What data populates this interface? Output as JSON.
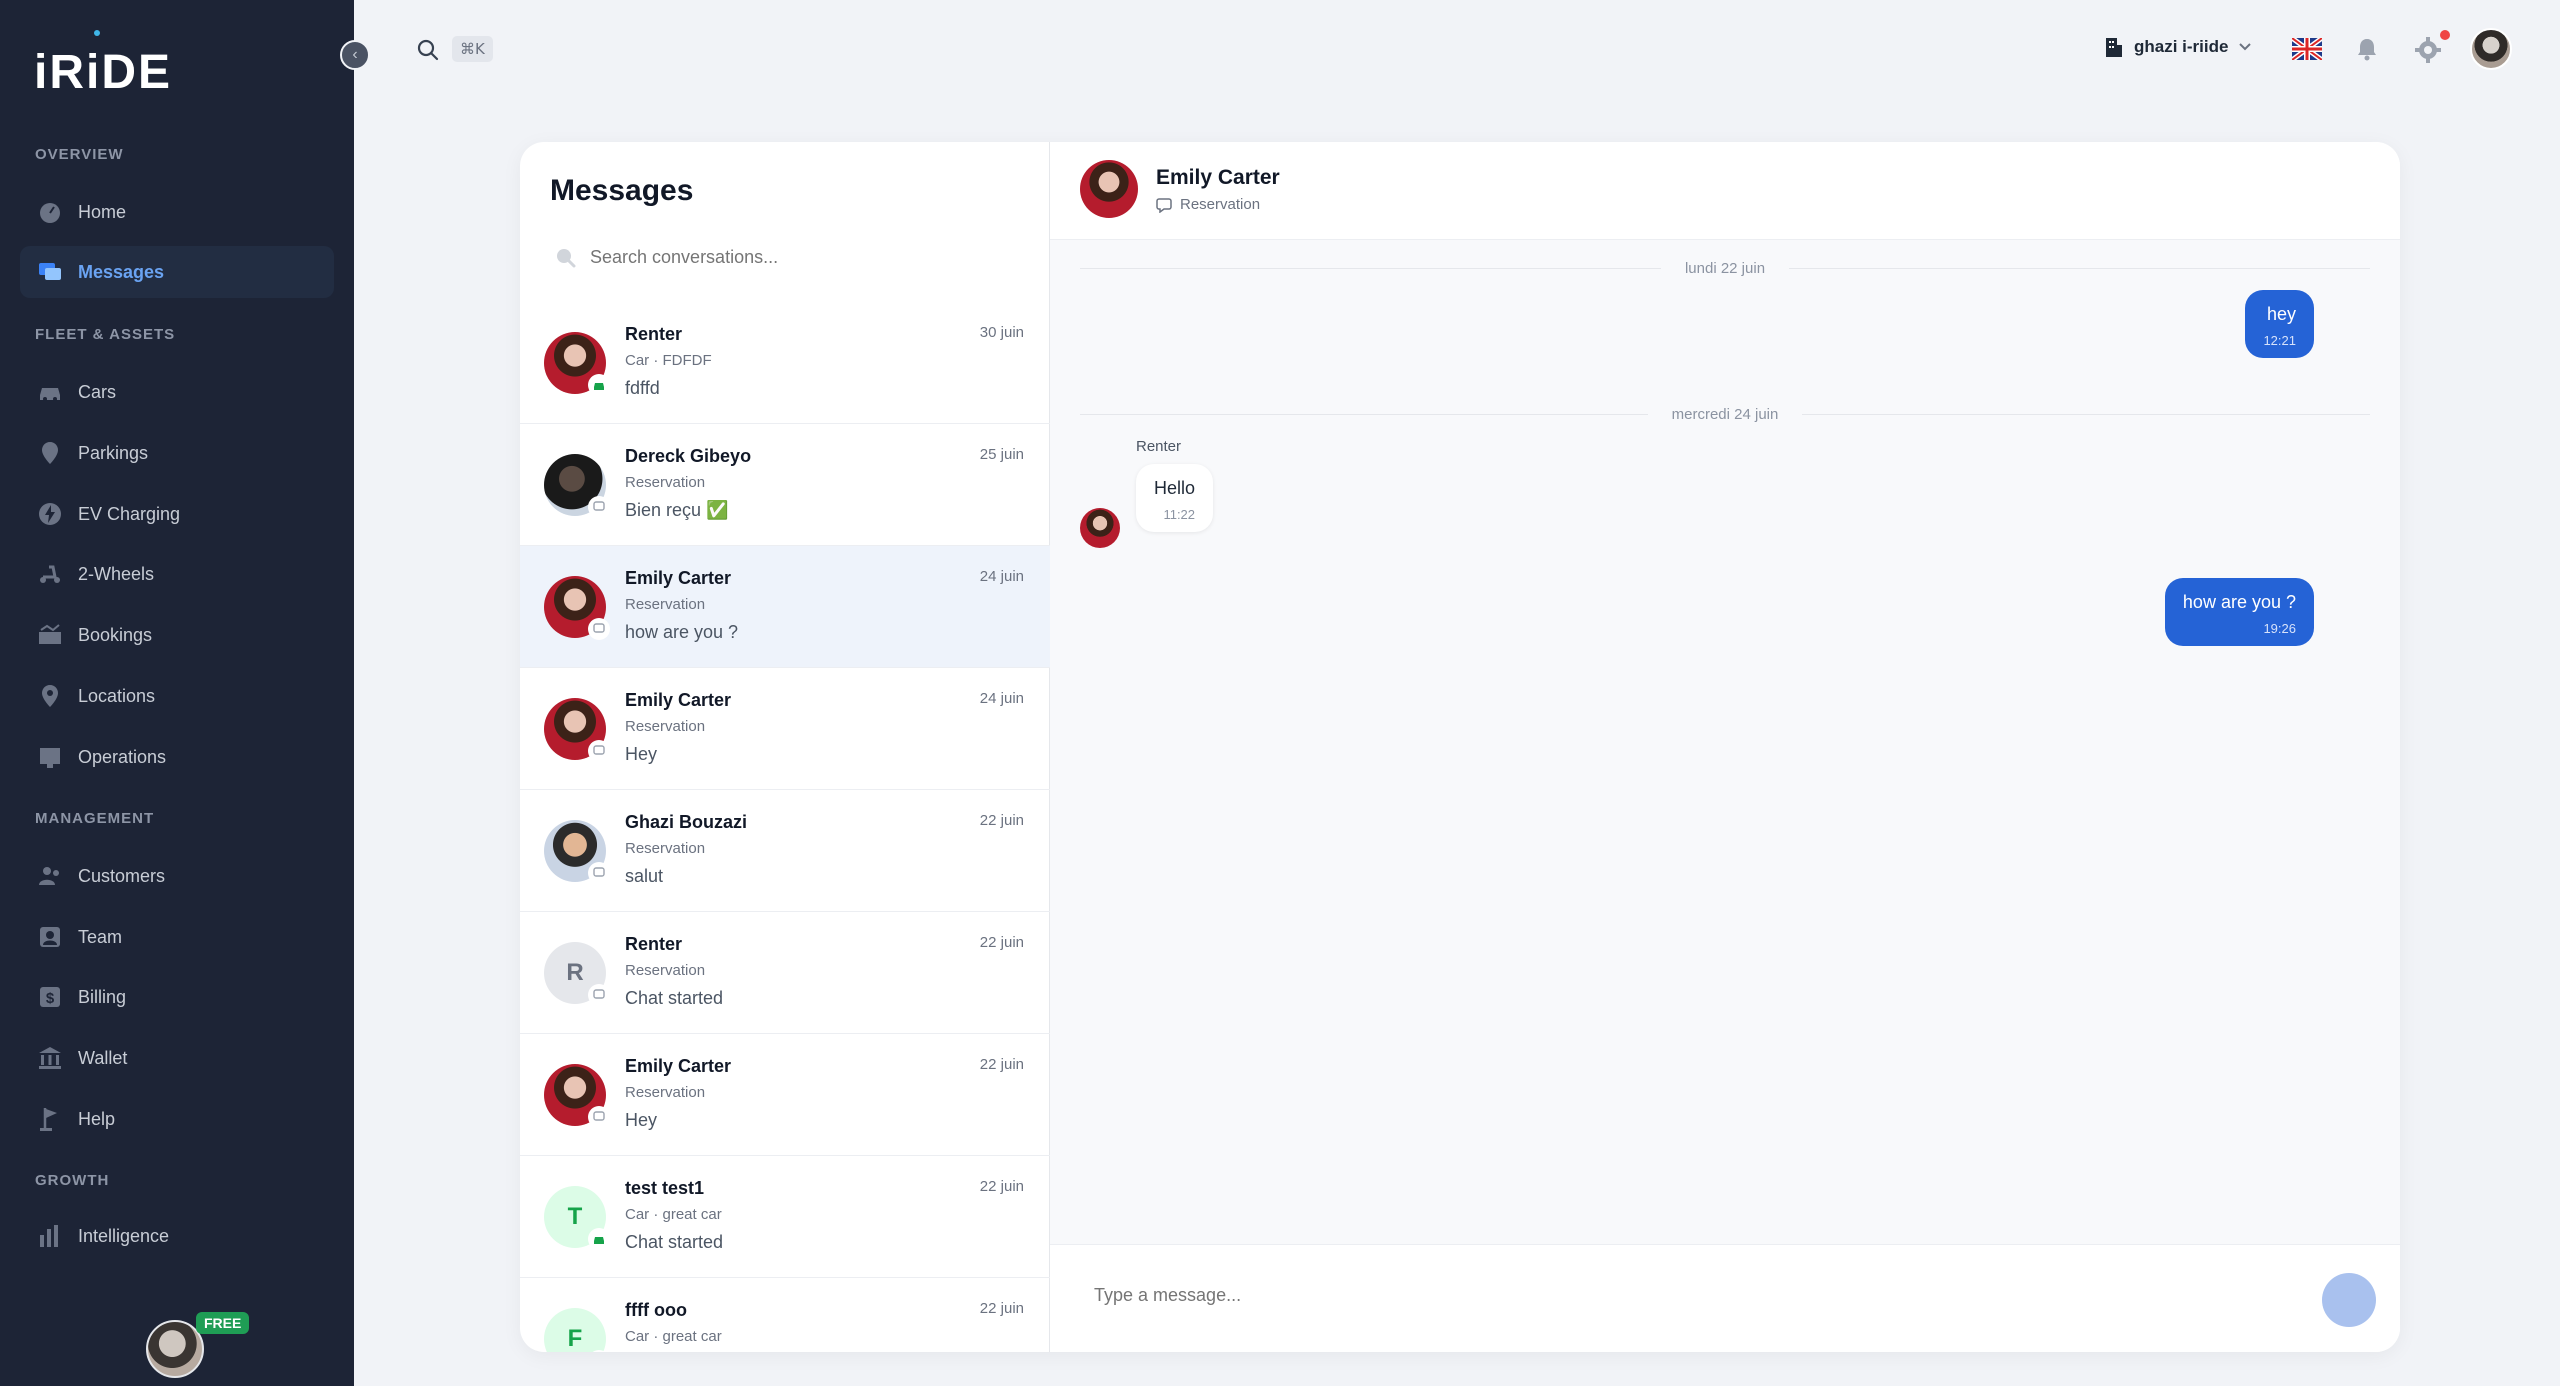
{
  "app": {
    "brand": "iRiDE",
    "shortcut": "⌘K",
    "org_name": "ghazi i-riide",
    "plan_badge": "FREE"
  },
  "sidebar": {
    "sections": [
      {
        "title": "OVERVIEW",
        "items": [
          {
            "label": "Home",
            "icon": "speedometer-icon"
          },
          {
            "label": "Messages",
            "icon": "chat-icon",
            "active": true
          }
        ]
      },
      {
        "title": "FLEET & ASSETS",
        "items": [
          {
            "label": "Cars",
            "icon": "car-icon"
          },
          {
            "label": "Parkings",
            "icon": "pin-icon"
          },
          {
            "label": "EV Charging",
            "icon": "bolt-icon"
          },
          {
            "label": "2-Wheels",
            "icon": "scooter-icon"
          },
          {
            "label": "Bookings",
            "icon": "calendar-icon"
          },
          {
            "label": "Locations",
            "icon": "location-icon"
          },
          {
            "label": "Operations",
            "icon": "clipboard-icon"
          }
        ]
      },
      {
        "title": "MANAGEMENT",
        "items": [
          {
            "label": "Customers",
            "icon": "users-icon"
          },
          {
            "label": "Team",
            "icon": "team-icon"
          },
          {
            "label": "Billing",
            "icon": "dollar-icon"
          },
          {
            "label": "Wallet",
            "icon": "bank-icon"
          },
          {
            "label": "Help",
            "icon": "flag-icon"
          }
        ]
      },
      {
        "title": "GROWTH",
        "items": [
          {
            "label": "Intelligence",
            "icon": "bar-chart-icon"
          }
        ]
      }
    ]
  },
  "conversations": {
    "title": "Messages",
    "search_placeholder": "Search conversations...",
    "items": [
      {
        "name": "Renter",
        "sub": "Car · FDFDF",
        "preview": "fdffd",
        "date": "30 juin",
        "avatar": "emily",
        "badge": "car"
      },
      {
        "name": "Dereck Gibeyo",
        "sub": "Reservation",
        "preview": "Bien reçu ✅",
        "date": "25 juin",
        "avatar": "dereck",
        "badge": "chat"
      },
      {
        "name": "Emily Carter",
        "sub": "Reservation",
        "preview": "how are you ?",
        "date": "24 juin",
        "avatar": "emily",
        "badge": "chat",
        "selected": true
      },
      {
        "name": "Emily Carter",
        "sub": "Reservation",
        "preview": "Hey",
        "date": "24 juin",
        "avatar": "emily",
        "badge": "chat"
      },
      {
        "name": "Ghazi Bouzazi",
        "sub": "Reservation",
        "preview": "salut",
        "date": "22 juin",
        "avatar": "ghazi",
        "badge": "chat"
      },
      {
        "name": "Renter",
        "sub": "Reservation",
        "preview": "Chat started",
        "date": "22 juin",
        "avatar": "R",
        "badge": "chat"
      },
      {
        "name": "Emily Carter",
        "sub": "Reservation",
        "preview": "Hey",
        "date": "22 juin",
        "avatar": "emily",
        "badge": "chat"
      },
      {
        "name": "test test1",
        "sub": "Car · great car",
        "preview": "Chat started",
        "date": "22 juin",
        "avatar": "T",
        "badge": "car"
      },
      {
        "name": "ffff ooo",
        "sub": "Car · great car",
        "preview": "",
        "date": "22 juin",
        "avatar": "F",
        "badge": "car"
      }
    ]
  },
  "chat": {
    "contact_name": "Emily Carter",
    "contact_sub": "Reservation",
    "day1": "lundi 22 juin",
    "day2": "mercredi 24 juin",
    "msg1_text": "hey",
    "msg1_time": "12:21",
    "sender_label": "Renter",
    "msg2_text": "Hello",
    "msg2_time": "11:22",
    "msg3_text": "how are you ?",
    "msg3_time": "19:26",
    "composer_placeholder": "Type a message..."
  },
  "colors": {
    "sidebar_bg": "#1d2436",
    "accent": "#2563d6",
    "active_nav": "#6aa3f2",
    "badge_green": "#1f9d55"
  }
}
